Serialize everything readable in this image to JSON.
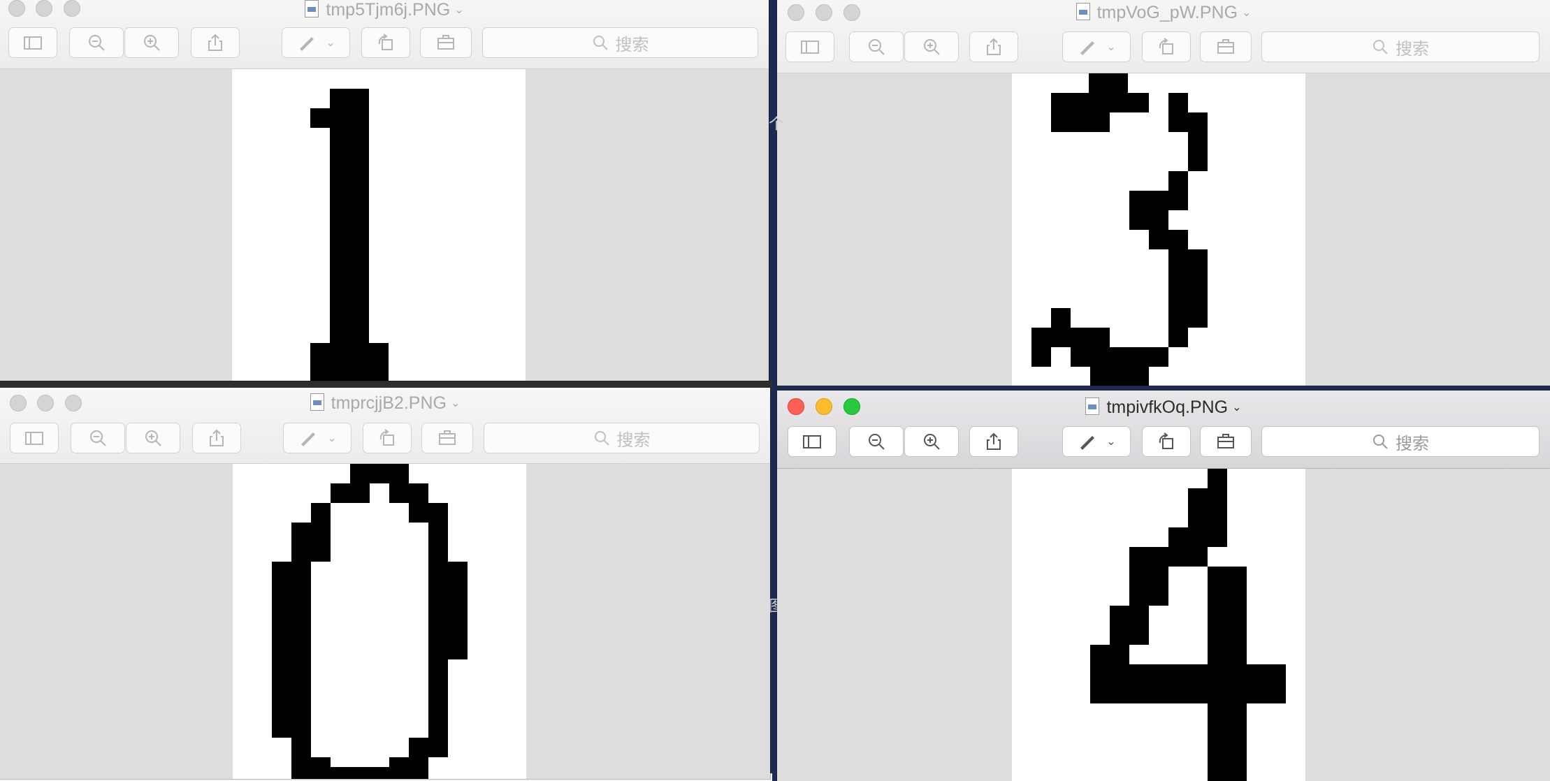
{
  "windows": [
    {
      "id": "w1",
      "title": "tmp5Tjm6j.PNG",
      "digit": "1",
      "active": false
    },
    {
      "id": "w2",
      "title": "tmpVoG_pW.PNG",
      "digit": "3",
      "active": false
    },
    {
      "id": "w3",
      "title": "tmprcjjB2.PNG",
      "digit": "0",
      "active": false
    },
    {
      "id": "w4",
      "title": "tmpivfkOq.PNG",
      "digit": "4",
      "active": true
    }
  ],
  "toolbar": {
    "search_placeholder": "搜索",
    "icons": [
      "sidebar-icon",
      "zoom-out-icon",
      "zoom-in-icon",
      "share-icon",
      "markup-icon",
      "rotate-icon",
      "toolbox-icon",
      "search-icon"
    ]
  },
  "colors": {
    "accent_red": "#fd5f57",
    "accent_yellow": "#febc2e",
    "accent_green": "#28c840",
    "canvas": "#dddddd",
    "desktop": "#1d2a52"
  }
}
